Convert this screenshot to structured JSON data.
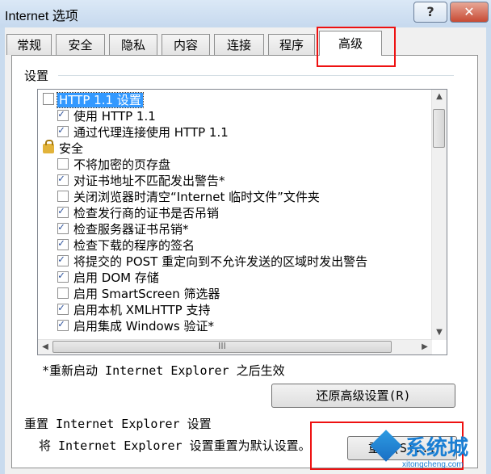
{
  "window": {
    "title": "Internet 选项",
    "help_label": "?",
    "close_label": "✕"
  },
  "tabs": [
    {
      "label": "常规"
    },
    {
      "label": "安全"
    },
    {
      "label": "隐私"
    },
    {
      "label": "内容"
    },
    {
      "label": "连接"
    },
    {
      "label": "程序"
    },
    {
      "label": "高级",
      "active": true
    }
  ],
  "settings": {
    "group_label": "设置",
    "items": [
      {
        "type": "category",
        "icon": "folder-icon",
        "label": "HTTP 1.1 设置",
        "selected": true
      },
      {
        "type": "checkbox",
        "checked": true,
        "label": "使用 HTTP 1.1"
      },
      {
        "type": "checkbox",
        "checked": true,
        "label": "通过代理连接使用 HTTP 1.1"
      },
      {
        "type": "category",
        "icon": "lock-icon",
        "label": "安全"
      },
      {
        "type": "checkbox",
        "checked": false,
        "label": "不将加密的页存盘"
      },
      {
        "type": "checkbox",
        "checked": true,
        "label": "对证书地址不匹配发出警告*"
      },
      {
        "type": "checkbox",
        "checked": false,
        "label": "关闭浏览器时清空“Internet 临时文件”文件夹"
      },
      {
        "type": "checkbox",
        "checked": true,
        "label": "检查发行商的证书是否吊销"
      },
      {
        "type": "checkbox",
        "checked": true,
        "label": "检查服务器证书吊销*"
      },
      {
        "type": "checkbox",
        "checked": true,
        "label": "检查下载的程序的签名"
      },
      {
        "type": "checkbox",
        "checked": true,
        "label": "将提交的 POST 重定向到不允许发送的区域时发出警告"
      },
      {
        "type": "checkbox",
        "checked": true,
        "label": "启用 DOM 存储"
      },
      {
        "type": "checkbox",
        "checked": false,
        "label": "启用 SmartScreen 筛选器"
      },
      {
        "type": "checkbox",
        "checked": true,
        "label": "启用本机 XMLHTTP 支持"
      },
      {
        "type": "checkbox",
        "checked": true,
        "label": "启用集成 Windows 验证*"
      }
    ],
    "hscroll_grip": "III"
  },
  "restart_note": "*重新启动 Internet Explorer 之后生效",
  "restore_button": "还原高级设置(R)",
  "reset": {
    "group_label": "重置 Internet Explorer 设置",
    "description": "将 Internet Explorer 设置重置为默认设置。",
    "button_label": "重置(S)..."
  },
  "watermark": {
    "brand": "系统城",
    "url": "xitongcheng.com"
  },
  "colors": {
    "selection": "#3399ff",
    "highlight_box": "#ee1111",
    "title_bar": "#c9dbee"
  }
}
